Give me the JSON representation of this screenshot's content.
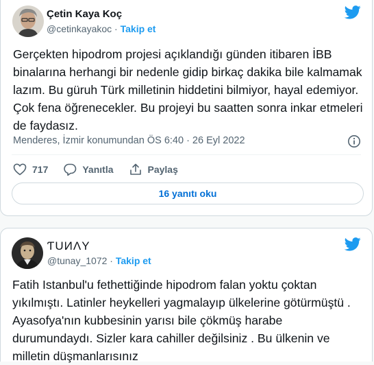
{
  "tweet1": {
    "author_name": "Çetin Kaya Koç",
    "handle": "@cetinkayakoc",
    "separator": " · ",
    "follow_label": "Takip et",
    "text": "Gerçekten hipodrom projesi açıklandığı günden itibaren İBB binalarına herhangi bir nedenle gidip birkaç dakika bile kalmamak lazım. Bu güruh Türk milletinin hiddetini bilmiyor, hayal edemiyor. Çok fena öğrenecekler. Bu projeyi bu saatten sonra inkar etmeleri de faydasız.",
    "meta": "Menderes, İzmir konumundan ÖS 6:40 · 26 Eyl 2022",
    "likes": "717",
    "reply_label": "Yanıtla",
    "share_label": "Paylaş",
    "replies_button": "16 yanıtı oku"
  },
  "tweet2": {
    "author_name": "ƬUИΛY",
    "handle": "@tunay_1072",
    "separator": " · ",
    "follow_label": "Takip et",
    "text": "Fatih Istanbul'u fethettiğinde hipodrom falan yoktu çoktan yıkılmıştı. Latinler heykelleri yagmalayıp ülkelerine götürmüştü . Ayasofya'nın kubbesinin yarısı bile çökmüş harabe durumundaydı. Sizler kara cahiller değilsiniz . Bu ülkenin ve milletin düşmanlarısınız"
  },
  "colors": {
    "accent": "#1d9bf0",
    "text": "#0f1419",
    "muted": "#536471",
    "border": "#cfd9de"
  },
  "icons": [
    "twitter-bird-icon",
    "info-icon",
    "heart-icon",
    "reply-icon",
    "share-icon"
  ]
}
